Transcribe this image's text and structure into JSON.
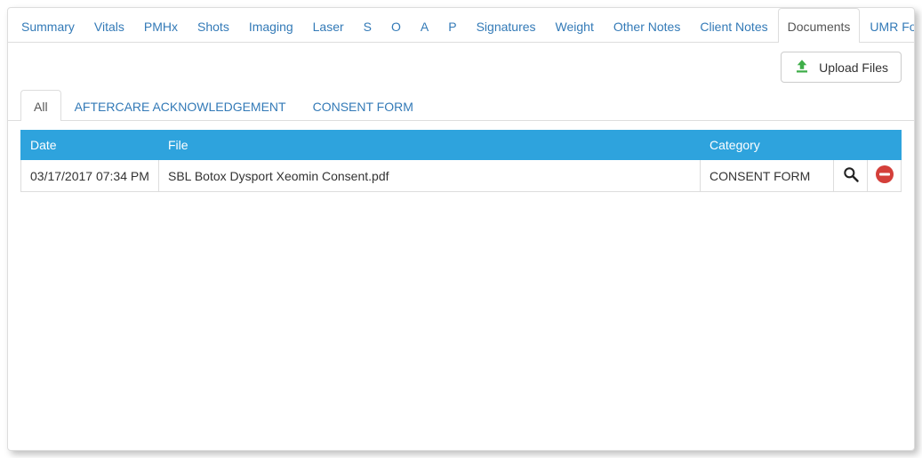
{
  "mainTabs": [
    "Summary",
    "Vitals",
    "PMHx",
    "Shots",
    "Imaging",
    "Laser",
    "S",
    "O",
    "A",
    "P",
    "Signatures",
    "Weight",
    "Other Notes",
    "Client Notes",
    "Documents",
    "UMR Forms"
  ],
  "activeMainTab": "Documents",
  "uploadLabel": "Upload Files",
  "subTabs": [
    "All",
    "AFTERCARE ACKNOWLEDGEMENT",
    "CONSENT FORM"
  ],
  "activeSubTab": "All",
  "columns": {
    "date": "Date",
    "file": "File",
    "category": "Category"
  },
  "rows": [
    {
      "date": "03/17/2017 07:34 PM",
      "file": "SBL Botox Dysport Xeomin Consent.pdf",
      "category": "CONSENT FORM"
    }
  ]
}
